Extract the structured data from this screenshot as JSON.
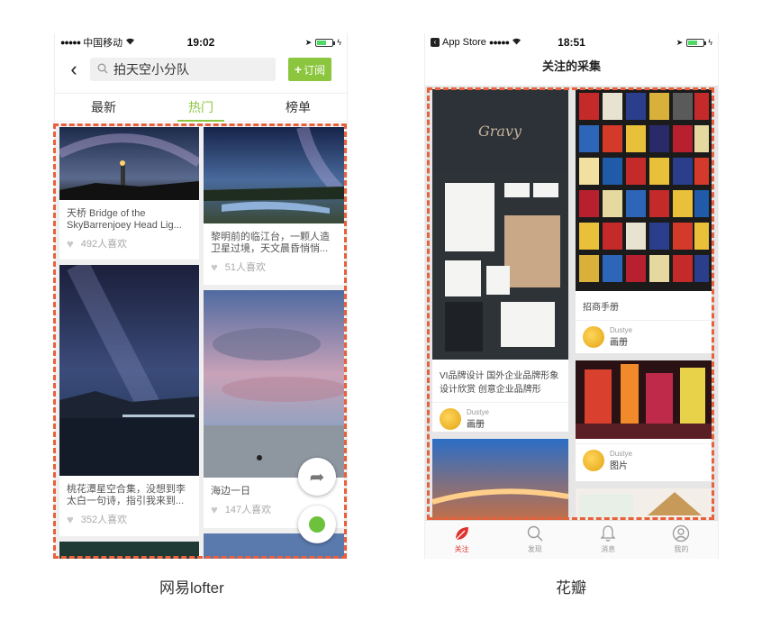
{
  "colors": {
    "accent_green": "#8cc63e",
    "accent_red": "#e0332d",
    "dash_red": "#e8603c"
  },
  "phone1": {
    "status": {
      "carrier": "中国移动",
      "time": "19:02"
    },
    "nav": {
      "back_icon": "chevron-left-icon",
      "search_icon": "search-icon",
      "search_value": "拍天空小分队",
      "subscribe_label": "订阅"
    },
    "tabs": [
      "最新",
      "热门",
      "榜单"
    ],
    "active_tab": "热门",
    "cards": [
      {
        "title": "天桥 Bridge of the SkyBarrenjoey Head Lig...",
        "likes": "492人喜欢"
      },
      {
        "title": "黎明前的临江台，一颗人造卫星过境，天文晨昏悄悄...",
        "likes": "51人喜欢"
      },
      {
        "title": "桃花潭星空合集，没想到李太白一句诗，指引我来到...",
        "likes": "352人喜欢"
      },
      {
        "title": "海边一日",
        "likes": "147人喜欢"
      }
    ],
    "caption": "网易lofter"
  },
  "phone2": {
    "status": {
      "back_app": "App Store",
      "time": "18:51"
    },
    "title": "关注的采集",
    "cards": [
      {
        "logo_text": "Gravy",
        "desc": "VI品牌设计 国外企业品牌形象设计欣赏 创意企业品牌形",
        "author": "Dustye",
        "type": "画册"
      },
      {
        "desc": "招商手册",
        "author": "Dustye",
        "type": "画册"
      },
      {
        "desc": "",
        "author": "Dustye",
        "type": "图片"
      }
    ],
    "tabbar": [
      {
        "label": "关注",
        "icon": "leaf-icon"
      },
      {
        "label": "发现",
        "icon": "search-icon"
      },
      {
        "label": "消息",
        "icon": "bell-icon"
      },
      {
        "label": "我的",
        "icon": "user-icon"
      }
    ],
    "caption": "花瓣"
  }
}
